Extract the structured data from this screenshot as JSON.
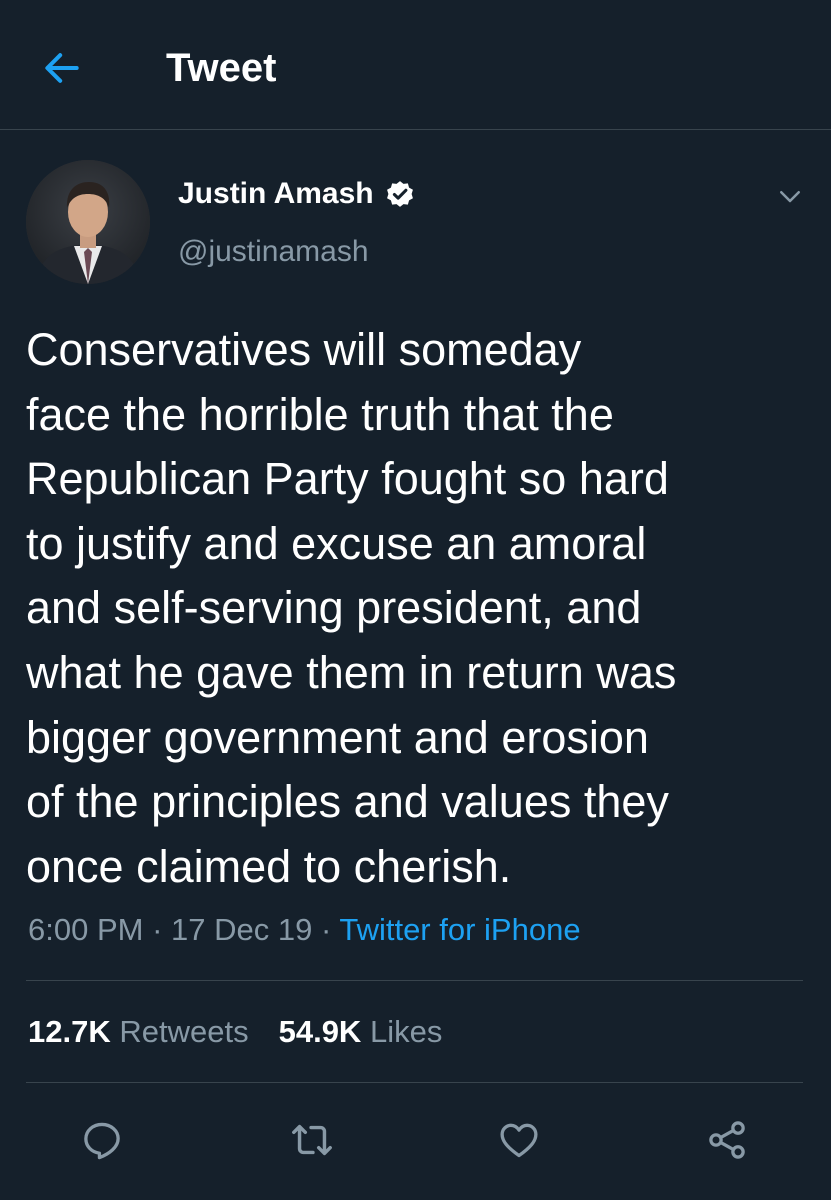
{
  "header": {
    "title": "Tweet",
    "back_icon": "arrow-left-icon"
  },
  "colors": {
    "background": "#15202b",
    "accent": "#1da1f2",
    "secondary_text": "#8899a6",
    "divider": "#38444d"
  },
  "tweet": {
    "author": {
      "display_name": "Justin Amash",
      "handle": "@justinamash",
      "verified_icon": "verified-badge-icon"
    },
    "text_lines": [
      "Conservatives will someday",
      "face the horrible truth that the",
      "Republican Party fought so hard",
      "to justify and excuse an amoral",
      "and self-serving president, and",
      "what he gave them in return was",
      "bigger government and erosion",
      "of the principles and values they",
      "once claimed to cherish."
    ],
    "time": "6:00 PM",
    "separator": " · ",
    "date": "17 Dec 19",
    "source": "Twitter for iPhone"
  },
  "stats": {
    "retweets_count": "12.7K",
    "retweets_label": "Retweets",
    "likes_count": "54.9K",
    "likes_label": "Likes"
  },
  "actions": [
    {
      "icon": "reply-icon"
    },
    {
      "icon": "retweet-icon"
    },
    {
      "icon": "like-heart-icon"
    },
    {
      "icon": "share-icon"
    }
  ]
}
